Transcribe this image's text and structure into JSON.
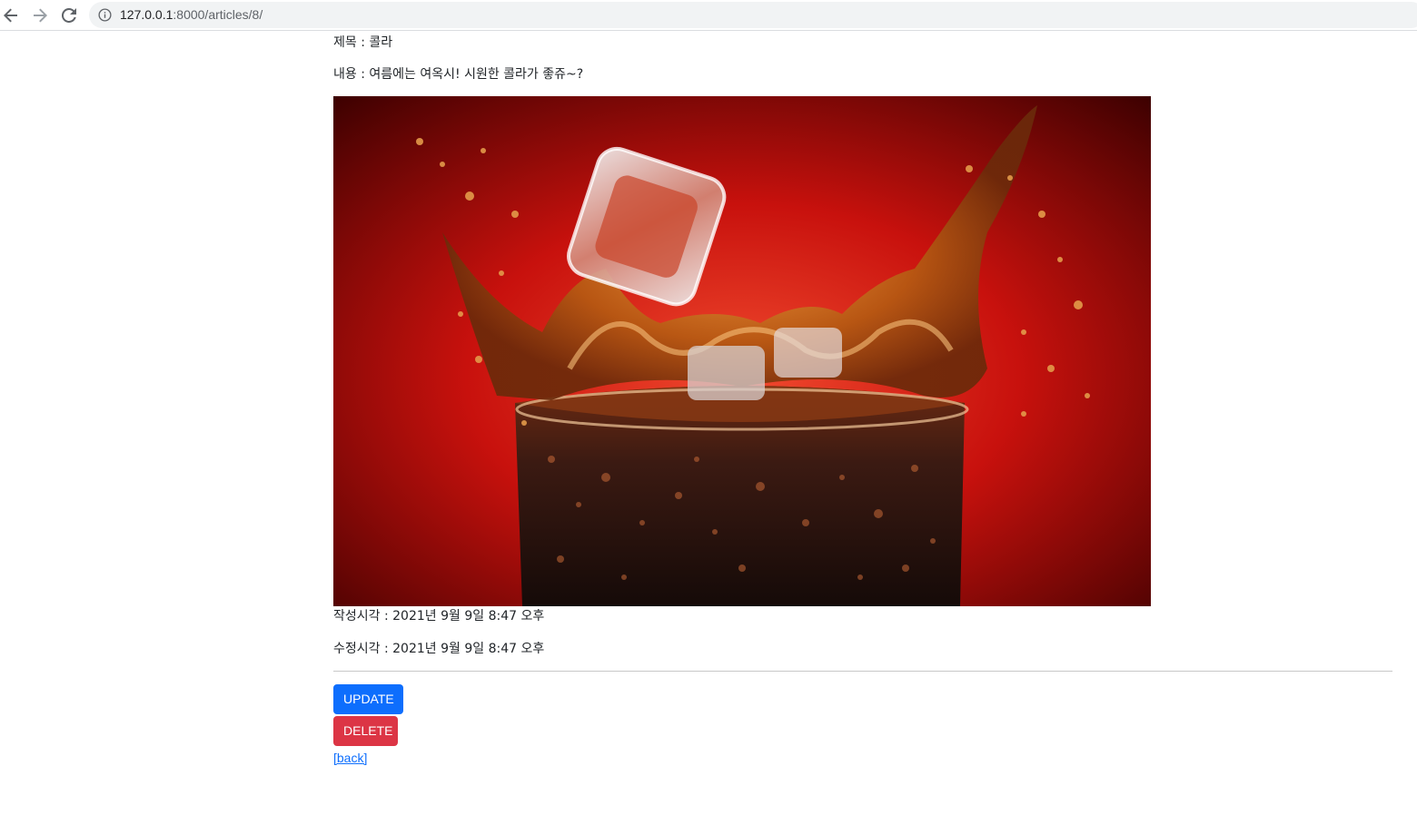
{
  "browser": {
    "url_host": "127.0.0.1",
    "url_rest": ":8000/articles/8/"
  },
  "article": {
    "title_label": "제목 : ",
    "title": "콜라",
    "content_label": "내용 : ",
    "content": "여름에는 여옥시! 시원한 콜라가 좋쥬~?",
    "created_label": "작성시각 : ",
    "created_at": "2021년 9월 9일 8:47 오후",
    "updated_label": "수정시각 : ",
    "updated_at": "2021년 9월 9일 8:47 오후"
  },
  "actions": {
    "update_label": "UPDATE",
    "delete_label": "DELETE",
    "back_label": "[back]"
  },
  "colors": {
    "primary": "#0d6efd",
    "danger": "#dc3545",
    "text": "#212529"
  },
  "icons": {
    "back": "arrow-left-icon",
    "forward": "arrow-right-icon",
    "reload": "reload-icon",
    "info": "info-icon"
  }
}
